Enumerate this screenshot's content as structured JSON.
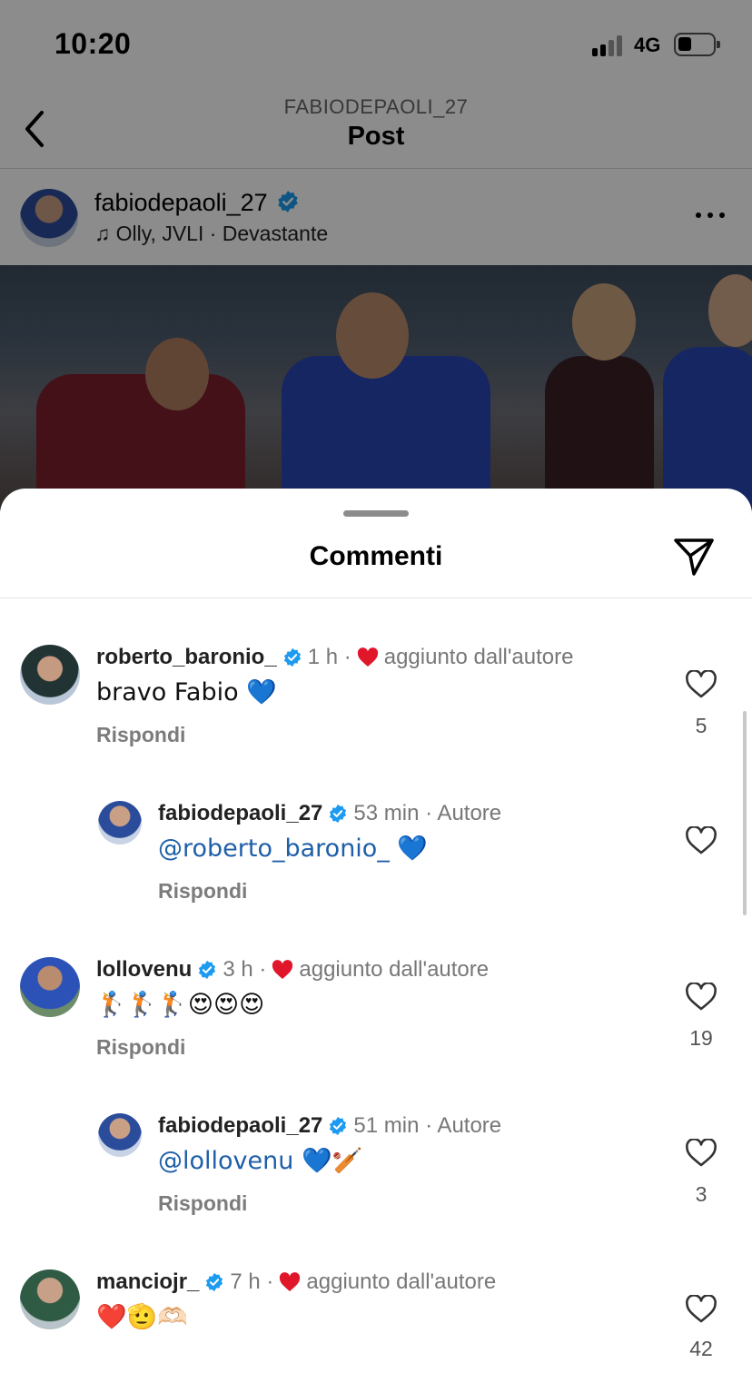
{
  "status_bar": {
    "time": "10:20",
    "network": "4G"
  },
  "nav": {
    "subtitle": "FABIODEPAOLI_27",
    "title": "Post"
  },
  "post": {
    "username": "fabiodepaoli_27",
    "music": "♫ Olly, JVLI · Devastante"
  },
  "sheet": {
    "title": "Commenti"
  },
  "comments": [
    {
      "username": "roberto_baronio_",
      "time": "1 h ·",
      "tag": "aggiunto dall'autore",
      "text": "bravo Fabio 💙",
      "reply": "Rispondi",
      "likes": "5"
    },
    {
      "username": "fabiodepaoli_27",
      "time": "53 min · Autore",
      "text": "@roberto_baronio_ 💙",
      "reply": "Rispondi",
      "likes": ""
    },
    {
      "username": "lollovenu",
      "time": "3 h ·",
      "tag": "aggiunto dall'autore",
      "text": "🏌️🏌️🏌️😍😍😍",
      "reply": "Rispondi",
      "likes": "19"
    },
    {
      "username": "fabiodepaoli_27",
      "time": "51 min · Autore",
      "text": "@lollovenu 💙🏏",
      "reply": "Rispondi",
      "likes": "3"
    },
    {
      "username": "manciojr_",
      "time": "7 h ·",
      "tag": "aggiunto dall'autore",
      "text": "❤️🫡🫶🏻",
      "reply": "",
      "likes": "42"
    }
  ],
  "colors": {
    "accent_link": "#1f5fa8",
    "verified": "#1d9bf0",
    "heart": "#e0172b"
  },
  "icons": [
    "back-chevron-icon",
    "more-icon",
    "send-icon",
    "verified-icon",
    "heart-icon",
    "music-note-icon"
  ]
}
